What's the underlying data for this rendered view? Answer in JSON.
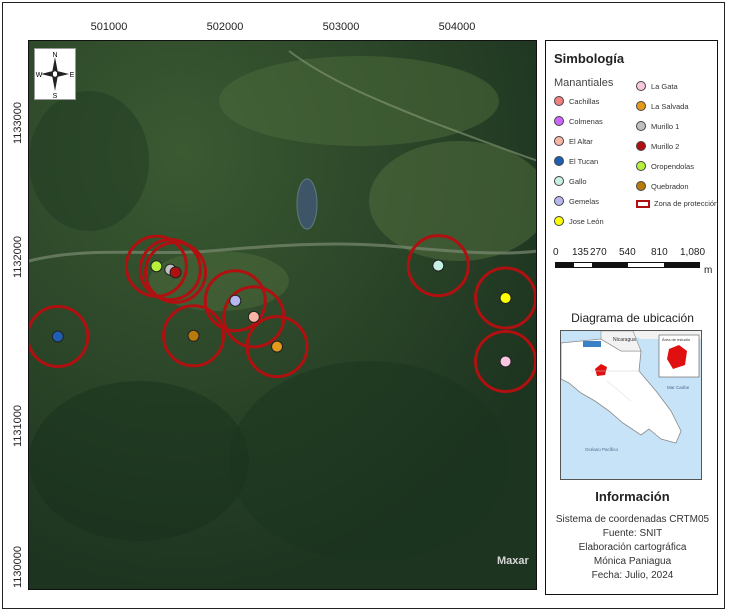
{
  "axes": {
    "x_ticks": [
      "501000",
      "502000",
      "503000",
      "504000"
    ],
    "y_ticks": [
      "1133000",
      "1132000",
      "1131000",
      "1130000"
    ]
  },
  "compass": {
    "n": "N",
    "s": "S",
    "e": "E",
    "w": "W"
  },
  "watermark": "Maxar",
  "legend": {
    "title": "Simbología",
    "subtitle": "Manantiales",
    "items": [
      {
        "label": "Cachillas",
        "color": "#f08080"
      },
      {
        "label": "Colmenas",
        "color": "#cc66ff"
      },
      {
        "label": "El Altar",
        "color": "#f7b5a6"
      },
      {
        "label": "El Tucan",
        "color": "#1f5fb3"
      },
      {
        "label": "Gallo",
        "color": "#c7f0e4"
      },
      {
        "label": "Gemelas",
        "color": "#b7b7f0"
      },
      {
        "label": "Jose León",
        "color": "#ffff00"
      },
      {
        "label": "La Gata",
        "color": "#f9c8e0"
      },
      {
        "label": "La Salvada",
        "color": "#e39a1a"
      },
      {
        "label": "Murillo 1",
        "color": "#c0c0c0"
      },
      {
        "label": "Murillo 2",
        "color": "#b01010"
      },
      {
        "label": "Oropendolas",
        "color": "#b6f03a"
      },
      {
        "label": "Quebradon",
        "color": "#b87a0a"
      }
    ],
    "zone_label": "Zona de protección",
    "zone_color": "#b01010"
  },
  "scale": {
    "labels": [
      "0",
      "135",
      "270",
      "540",
      "810",
      "1,080"
    ],
    "unit": "m"
  },
  "location": {
    "title": "Diagrama de ubicación",
    "labels": {
      "nicaragua": "Nicaragua",
      "study": "Área de estudio",
      "caribbean": "Mar Caribe",
      "pacific": "Océano Pacífico"
    }
  },
  "info": {
    "title": "Información",
    "lines": [
      "Sistema de coordenadas CRTM05",
      "Fuente: SNIT",
      "Elaboración cartográfica",
      "Mónica Paniagua",
      "Fecha: Julio, 2024"
    ]
  },
  "springs": [
    {
      "name": "Oropendolas",
      "color": "#b6f03a",
      "x": 501400,
      "y": 1132035
    },
    {
      "name": "Murillo 1",
      "color": "#c0c0c0",
      "x": 501520,
      "y": 1132010
    },
    {
      "name": "Murillo 2",
      "color": "#b01010",
      "x": 501565,
      "y": 1131990
    },
    {
      "name": "El Tucan",
      "color": "#1f5fb3",
      "x": 500550,
      "y": 1131515
    },
    {
      "name": "Quebradon",
      "color": "#b87a0a",
      "x": 501720,
      "y": 1131520
    },
    {
      "name": "Gemelas",
      "color": "#b7b7f0",
      "x": 502080,
      "y": 1131780
    },
    {
      "name": "El Altar",
      "color": "#f7b5a6",
      "x": 502240,
      "y": 1131660
    },
    {
      "name": "La Salvada",
      "color": "#e39a1a",
      "x": 502440,
      "y": 1131440
    },
    {
      "name": "Gallo",
      "color": "#c7f0e4",
      "x": 503830,
      "y": 1132040
    },
    {
      "name": "Jose León",
      "color": "#ffff00",
      "x": 504410,
      "y": 1131800
    },
    {
      "name": "La Gata",
      "color": "#f9c8e0",
      "x": 504410,
      "y": 1131330
    }
  ]
}
